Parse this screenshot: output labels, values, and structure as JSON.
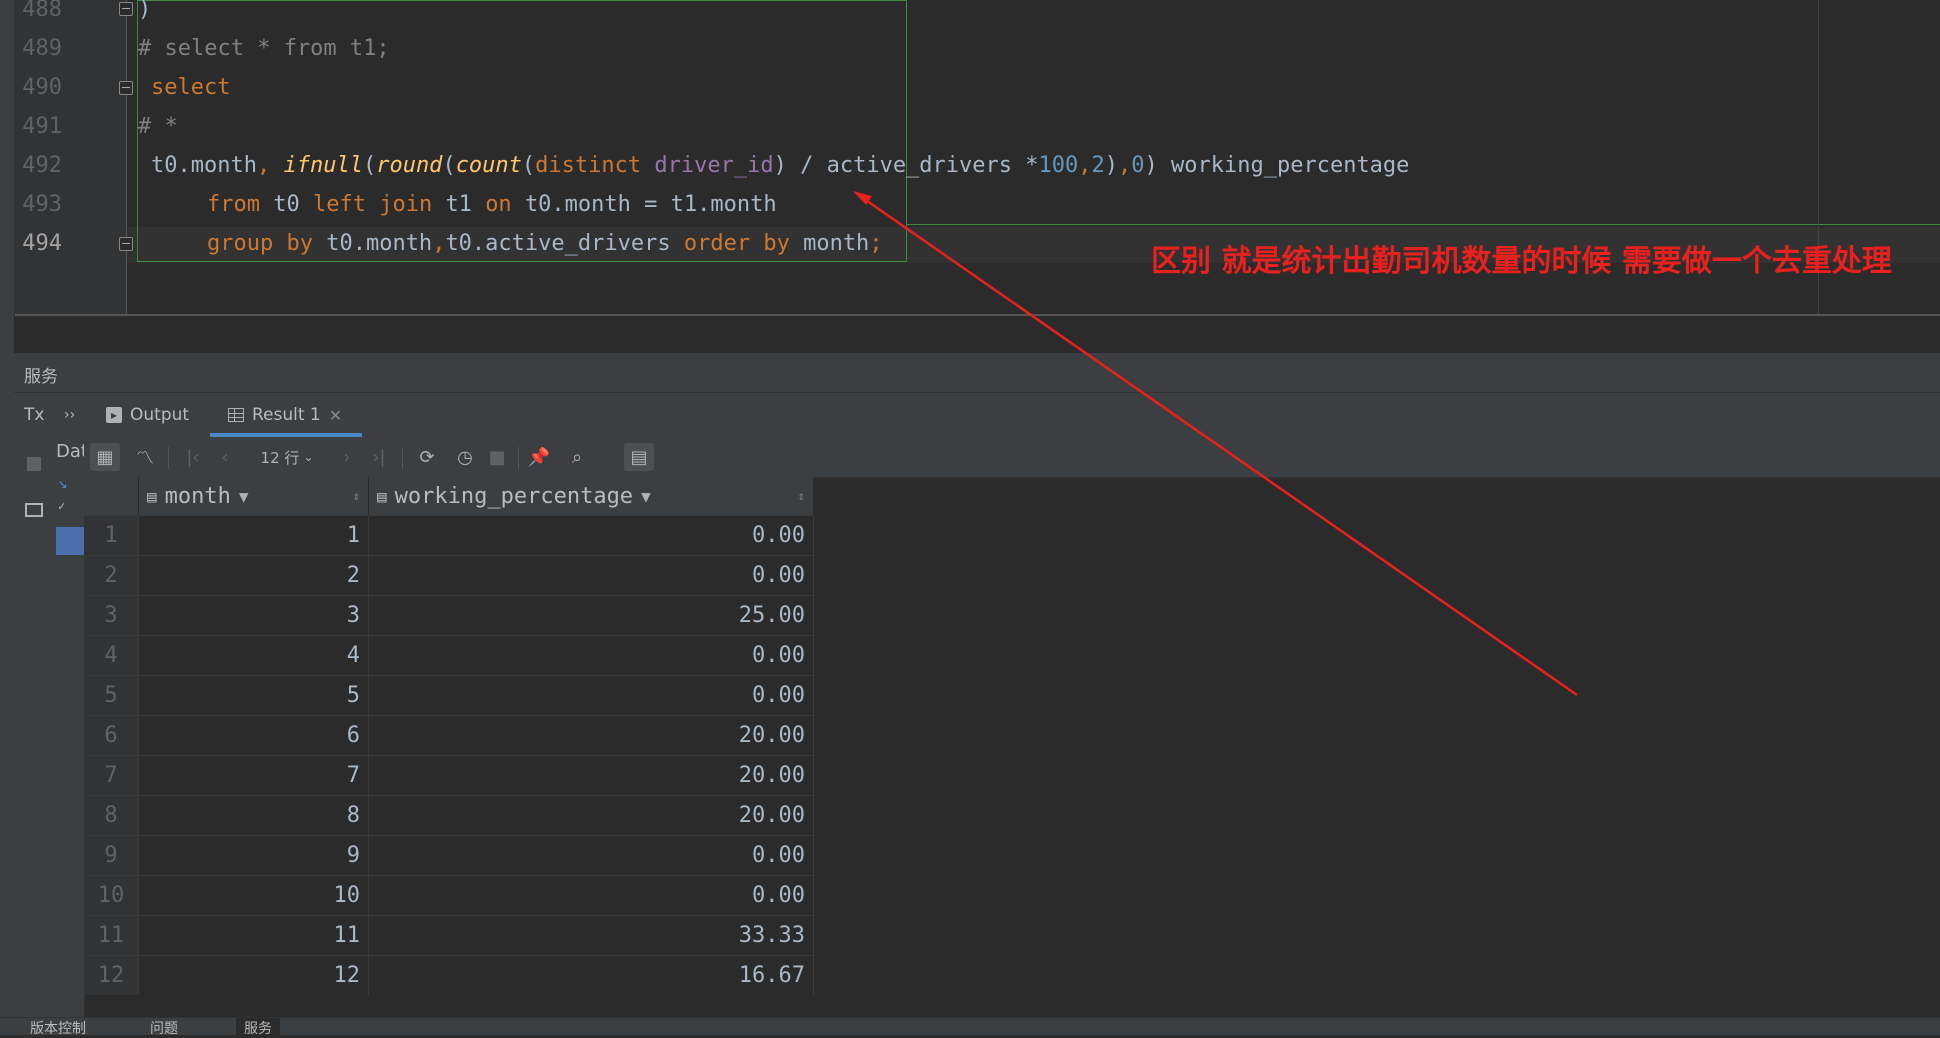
{
  "editor": {
    "lines": [
      {
        "no": "488",
        "text": ")"
      },
      {
        "no": "489",
        "text": "# select * from t1;"
      },
      {
        "no": "490",
        "text": "select"
      },
      {
        "no": "491",
        "text": "# *"
      },
      {
        "no": "492",
        "text": "t0.month, ifnull(round(count(distinct driver_id) / active_drivers *100,2),0) working_percentage"
      },
      {
        "no": "493",
        "text": "from t0 left join t1 on t0.month = t1.month"
      },
      {
        "no": "494",
        "text": "group by t0.month,t0.active_drivers order by month;"
      }
    ]
  },
  "annotation": {
    "note": "区别 就是统计出勤司机数量的时候 需要做一个去重处理",
    "color": "#e8201e"
  },
  "services": {
    "title": "服务",
    "side_tab_tx": "Tx",
    "side_tab_more": "››",
    "side_tab_dat": "Dat",
    "tabs": [
      {
        "label": "Output"
      },
      {
        "label": "Result 1"
      }
    ],
    "toolbar": {
      "rows_label": "12 行"
    }
  },
  "grid": {
    "columns": [
      "month",
      "working_percentage"
    ],
    "rows": [
      {
        "n": "1",
        "month": "1",
        "wp": "0.00"
      },
      {
        "n": "2",
        "month": "2",
        "wp": "0.00"
      },
      {
        "n": "3",
        "month": "3",
        "wp": "25.00"
      },
      {
        "n": "4",
        "month": "4",
        "wp": "0.00"
      },
      {
        "n": "5",
        "month": "5",
        "wp": "0.00"
      },
      {
        "n": "6",
        "month": "6",
        "wp": "20.00"
      },
      {
        "n": "7",
        "month": "7",
        "wp": "20.00"
      },
      {
        "n": "8",
        "month": "8",
        "wp": "20.00"
      },
      {
        "n": "9",
        "month": "9",
        "wp": "0.00"
      },
      {
        "n": "10",
        "month": "10",
        "wp": "0.00"
      },
      {
        "n": "11",
        "month": "11",
        "wp": "33.33"
      },
      {
        "n": "12",
        "month": "12",
        "wp": "16.67"
      }
    ]
  },
  "status": {
    "items": [
      "版本控制",
      "问题",
      "服务"
    ]
  }
}
